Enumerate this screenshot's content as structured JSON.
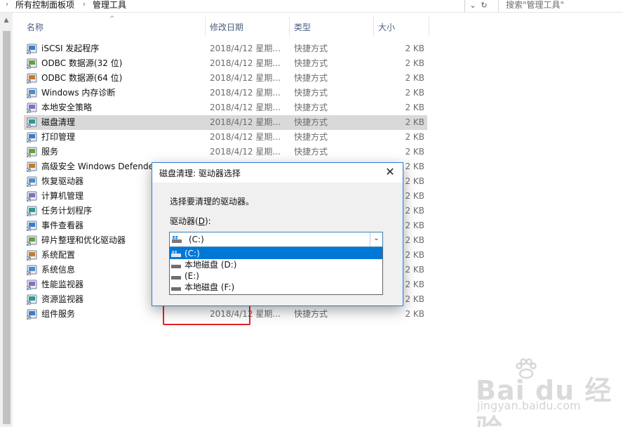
{
  "address": {
    "crumbs": [
      "所有控制面板项",
      "管理工具"
    ],
    "search_placeholder": "搜索\"管理工具\""
  },
  "columns": {
    "name": "名称",
    "date": "修改日期",
    "type": "类型",
    "size": "大小"
  },
  "files": [
    {
      "name": "iSCSI 发起程序",
      "date": "2018/4/12 星期...",
      "type": "快捷方式",
      "size": "2 KB",
      "icon": "iscsi-globe-icon"
    },
    {
      "name": "ODBC 数据源(32 位)",
      "date": "2018/4/12 星期...",
      "type": "快捷方式",
      "size": "2 KB",
      "icon": "odbc-icon"
    },
    {
      "name": "ODBC 数据源(64 位)",
      "date": "2018/4/12 星期...",
      "type": "快捷方式",
      "size": "2 KB",
      "icon": "odbc-icon"
    },
    {
      "name": "Windows 内存诊断",
      "date": "2018/4/12 星期...",
      "type": "快捷方式",
      "size": "2 KB",
      "icon": "memory-diagnostic-icon"
    },
    {
      "name": "本地安全策略",
      "date": "2018/4/12 星期...",
      "type": "快捷方式",
      "size": "2 KB",
      "icon": "security-policy-icon"
    },
    {
      "name": "磁盘清理",
      "date": "2018/4/12 星期...",
      "type": "快捷方式",
      "size": "2 KB",
      "icon": "disk-cleanup-icon",
      "selected": true
    },
    {
      "name": "打印管理",
      "date": "2018/4/12 星期...",
      "type": "快捷方式",
      "size": "2 KB",
      "icon": "printer-icon"
    },
    {
      "name": "服务",
      "date": "2018/4/12 星期...",
      "type": "快捷方式",
      "size": "2 KB",
      "icon": "services-gear-icon"
    },
    {
      "name": "高级安全 Windows Defende",
      "date": "",
      "type": "",
      "size": "2 KB",
      "icon": "firewall-icon"
    },
    {
      "name": "恢复驱动器",
      "date": "",
      "type": "",
      "size": "2 KB",
      "icon": "recovery-drive-icon"
    },
    {
      "name": "计算机管理",
      "date": "",
      "type": "",
      "size": "2 KB",
      "icon": "computer-management-icon"
    },
    {
      "name": "任务计划程序",
      "date": "",
      "type": "",
      "size": "2 KB",
      "icon": "task-scheduler-icon"
    },
    {
      "name": "事件查看器",
      "date": "",
      "type": "",
      "size": "2 KB",
      "icon": "event-viewer-icon"
    },
    {
      "name": "碎片整理和优化驱动器",
      "date": "",
      "type": "",
      "size": "2 KB",
      "icon": "defrag-icon"
    },
    {
      "name": "系统配置",
      "date": "",
      "type": "",
      "size": "2 KB",
      "icon": "system-config-icon"
    },
    {
      "name": "系统信息",
      "date": "",
      "type": "",
      "size": "2 KB",
      "icon": "system-info-icon"
    },
    {
      "name": "性能监视器",
      "date": "",
      "type": "",
      "size": "2 KB",
      "icon": "performance-monitor-icon"
    },
    {
      "name": "资源监视器",
      "date": "",
      "type": "",
      "size": "2 KB",
      "icon": "resource-monitor-icon"
    },
    {
      "name": "组件服务",
      "date": "2018/4/12 星期...",
      "type": "快捷方式",
      "size": "2 KB",
      "icon": "component-services-icon"
    }
  ],
  "dialog": {
    "title": "磁盘清理: 驱动器选择",
    "prompt": "选择要清理的驱动器。",
    "drive_label": "驱动器(D):",
    "selected_drive": "(C:)",
    "options": [
      "(C:)",
      "本地磁盘 (D:)",
      "(E:)",
      "本地磁盘 (F:)"
    ],
    "selected_index": 0
  },
  "colors": {
    "accent": "#0078d7",
    "selection_row": "#d9d9d9",
    "annotation": "#e4252a",
    "header_text": "#4d6082"
  },
  "watermark": {
    "logo": "Bai du 经验",
    "url": "jingyan.baidu.com"
  }
}
